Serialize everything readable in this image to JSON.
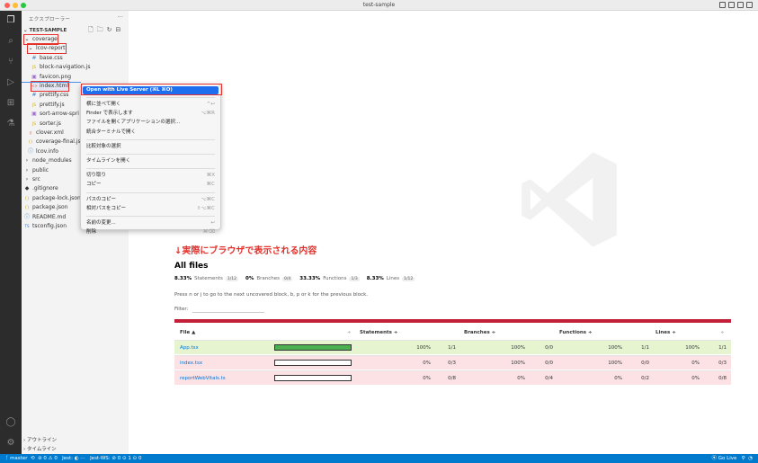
{
  "window": {
    "title": "test-sample"
  },
  "sidebar": {
    "header": "エクスプローラー",
    "more": "···",
    "project": "TEST-SAMPLE",
    "tree": [
      {
        "label": "coverage",
        "indent": 0,
        "type": "folder-open"
      },
      {
        "label": "lcov-report",
        "indent": 1,
        "type": "folder-open"
      },
      {
        "label": "base.css",
        "indent": 2,
        "type": "css"
      },
      {
        "label": "block-navigation.js",
        "indent": 2,
        "type": "js"
      },
      {
        "label": "favicon.png",
        "indent": 2,
        "type": "img"
      },
      {
        "label": "index.html",
        "indent": 2,
        "type": "html"
      },
      {
        "label": "prettify.css",
        "indent": 2,
        "type": "css"
      },
      {
        "label": "prettify.js",
        "indent": 2,
        "type": "js"
      },
      {
        "label": "sort-arrow-spri",
        "indent": 2,
        "type": "img"
      },
      {
        "label": "sorter.js",
        "indent": 2,
        "type": "js"
      },
      {
        "label": "clover.xml",
        "indent": 1,
        "type": "xml"
      },
      {
        "label": "coverage-final.js",
        "indent": 1,
        "type": "json"
      },
      {
        "label": "lcov.info",
        "indent": 1,
        "type": "info"
      },
      {
        "label": "node_modules",
        "indent": 0,
        "type": "folder"
      },
      {
        "label": "public",
        "indent": 0,
        "type": "folder"
      },
      {
        "label": "src",
        "indent": 0,
        "type": "folder"
      },
      {
        "label": ".gitignore",
        "indent": 0,
        "type": "git"
      },
      {
        "label": "package-lock.json",
        "indent": 0,
        "type": "json"
      },
      {
        "label": "package.json",
        "indent": 0,
        "type": "json"
      },
      {
        "label": "README.md",
        "indent": 0,
        "type": "info"
      },
      {
        "label": "tsconfig.json",
        "indent": 0,
        "type": "ts"
      }
    ],
    "outline": "アウトライン",
    "timeline": "タイムライン"
  },
  "context_menu": {
    "items": [
      {
        "label": "Open with Live Server (⌘L ⌘O)",
        "shortcut": ""
      },
      {
        "label": "横に並べて開く",
        "shortcut": "^↩"
      },
      {
        "label": "Finder で表示します",
        "shortcut": "⌥⌘R"
      },
      {
        "label": "ファイルを開くアプリケーションの選択...",
        "shortcut": ""
      },
      {
        "label": "統合ターミナルで開く",
        "shortcut": ""
      },
      {
        "label": "比較対象の選択",
        "shortcut": ""
      },
      {
        "label": "タイムラインを開く",
        "shortcut": ""
      },
      {
        "label": "切り取り",
        "shortcut": "⌘X"
      },
      {
        "label": "コピー",
        "shortcut": "⌘C"
      },
      {
        "label": "パスのコピー",
        "shortcut": "⌥⌘C"
      },
      {
        "label": "相対パスをコピー",
        "shortcut": "⇧⌥⌘C"
      },
      {
        "label": "名前の変更...",
        "shortcut": "↩"
      },
      {
        "label": "削除",
        "shortcut": "⌘⌫"
      }
    ]
  },
  "annotation": "↓実際にブラウザで表示される内容",
  "coverage": {
    "title": "All files",
    "stats": [
      {
        "pct": "8.33%",
        "name": "Statements",
        "frac": "1/12"
      },
      {
        "pct": "0%",
        "name": "Branches",
        "frac": "0/4"
      },
      {
        "pct": "33.33%",
        "name": "Functions",
        "frac": "1/3"
      },
      {
        "pct": "8.33%",
        "name": "Lines",
        "frac": "1/12"
      }
    ],
    "hint": "Press n or j to go to the next uncovered block, b, p or k for the previous block.",
    "filter_label": "Filter:",
    "headers": {
      "file": "File ▲",
      "statements": "Statements ÷",
      "branches": "Branches ÷",
      "functions": "Functions ÷",
      "lines": "Lines ÷",
      "sort1": "÷",
      "sort2": "÷",
      "sort3": "÷",
      "sort4": "÷",
      "sort5": "÷"
    },
    "rows": [
      {
        "file": "App.tsx",
        "coverage": 1.0,
        "st_pct": "100%",
        "st_frac": "1/1",
        "br_pct": "100%",
        "br_frac": "0/0",
        "fn_pct": "100%",
        "fn_frac": "1/1",
        "ln_pct": "100%",
        "ln_frac": "1/1",
        "color": "#e6f5d0"
      },
      {
        "file": "index.tsx",
        "coverage": 0.0,
        "st_pct": "0%",
        "st_frac": "0/3",
        "br_pct": "100%",
        "br_frac": "0/0",
        "fn_pct": "100%",
        "fn_frac": "0/0",
        "ln_pct": "0%",
        "ln_frac": "0/3",
        "color": "#fce1e5"
      },
      {
        "file": "reportWebVitals.ts",
        "coverage": 0.0,
        "st_pct": "0%",
        "st_frac": "0/8",
        "br_pct": "0%",
        "br_frac": "0/4",
        "fn_pct": "0%",
        "fn_frac": "0/2",
        "ln_pct": "0%",
        "ln_frac": "0/8",
        "color": "#fce1e5"
      }
    ]
  },
  "statusbar": {
    "branch": "master",
    "sync": "⟲",
    "problems": "⊘ 0 ⚠ 0",
    "jest": "Jest: ◐ ⋯",
    "jest_ws": "Jest-WS: ⊘ 0 ⊙ 1 ⊙ 0",
    "golive": "⦿ Go Live",
    "bell": "🔔"
  },
  "colors": {
    "accent": "#007acc",
    "highlight": "#1e6ff0",
    "annotation": "#e5322d",
    "redbar": "#c21f39",
    "green": "#4caf50"
  }
}
